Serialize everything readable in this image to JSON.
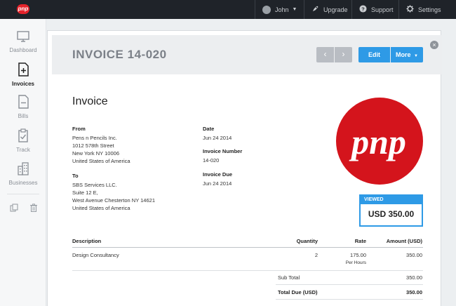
{
  "topbar": {
    "logo_text": "pnp",
    "user": "John",
    "upgrade": "Upgrade",
    "support": "Support",
    "settings": "Settings"
  },
  "sidebar": {
    "items": [
      {
        "label": "Dashboard",
        "icon": "monitor-icon"
      },
      {
        "label": "Invoices",
        "icon": "invoice-add-icon"
      },
      {
        "label": "Bills",
        "icon": "bill-minus-icon"
      },
      {
        "label": "Track",
        "icon": "clipboard-icon"
      },
      {
        "label": "Businesses",
        "icon": "building-icon"
      }
    ]
  },
  "invoice": {
    "title": "INVOICE 14-020",
    "edit_label": "Edit",
    "more_label": "More",
    "heading": "Invoice",
    "from_label": "From",
    "from_lines": [
      "Pens n Pencils Inc.",
      "1012 578th Street",
      "New York NY 10006",
      "United States of America"
    ],
    "to_label": "To",
    "to_lines": [
      "SBS Services LLC.",
      "Suite 12 E,",
      "West Avenue Chesterton NY 14621",
      "United States of America"
    ],
    "date_label": "Date",
    "date_value": "Jun 24 2014",
    "number_label": "Invoice Number",
    "number_value": "14-020",
    "due_label": "Invoice Due",
    "due_value": "Jun 24 2014",
    "status_label": "VIEWED",
    "status_amount": "USD 350.00",
    "logo_text": "pnp"
  },
  "table": {
    "headers": {
      "description": "Description",
      "quantity": "Quantity",
      "rate": "Rate",
      "amount": "Amount (USD)"
    },
    "rows": [
      {
        "description": "Design Consultancy",
        "quantity": "2",
        "rate": "175.00",
        "rate_unit": "Per Hours",
        "amount": "350.00"
      }
    ],
    "subtotal_label": "Sub Total",
    "subtotal_value": "350.00",
    "total_label": "Total Due (USD)",
    "total_value": "350.00"
  },
  "colors": {
    "accent": "#2e9ae6",
    "brand_red": "#e4232b",
    "topbar": "#1f2329"
  }
}
